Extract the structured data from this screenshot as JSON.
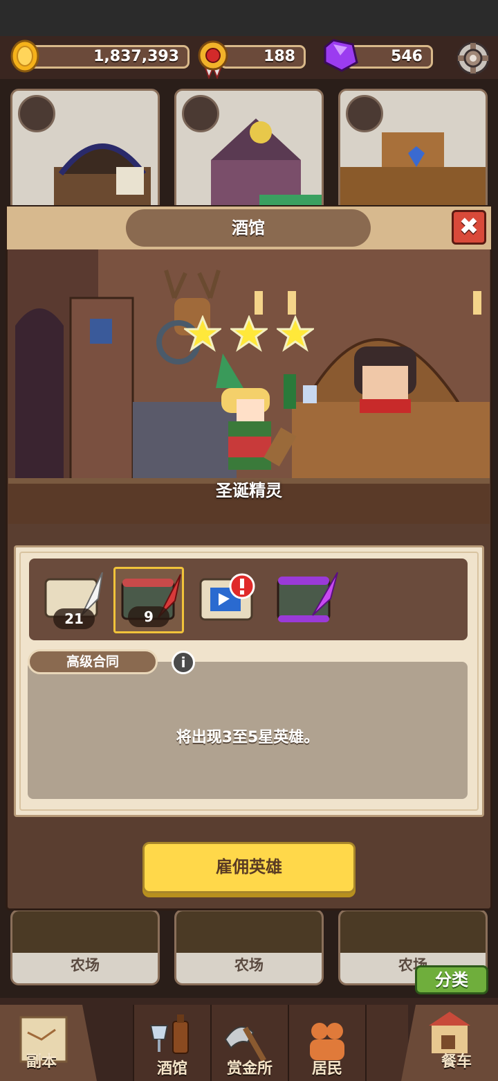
{
  "resources": {
    "gold": "1,837,393",
    "medal": "188",
    "gem": "546"
  },
  "dialog": {
    "title": "酒馆",
    "close": "✖",
    "hero_name": "圣诞精灵",
    "hero_stars": 3
  },
  "contracts": {
    "items": [
      {
        "name": "普通合同",
        "count": "21"
      },
      {
        "name": "高级合同",
        "count": "9"
      },
      {
        "name": "特殊合同",
        "count": ""
      },
      {
        "name": "紫色合同",
        "count": ""
      }
    ],
    "selected_label": "高级合同",
    "info_icon": "i",
    "description": "将出现3至5星英雄。"
  },
  "hire_button": "雇佣英雄",
  "buildings_bottom": [
    "农场",
    "农场",
    "农场"
  ],
  "classify_button": "分类",
  "nav": {
    "dungeon": "副本",
    "tavern": "酒馆",
    "bounty": "赏金所",
    "residents": "居民",
    "cart": "餐车"
  },
  "colors": {
    "accent_yellow": "#ffd84a",
    "close_red": "#d94a3a",
    "gem_purple": "#9b3cf0",
    "panel_cream": "#f0e3cc"
  }
}
